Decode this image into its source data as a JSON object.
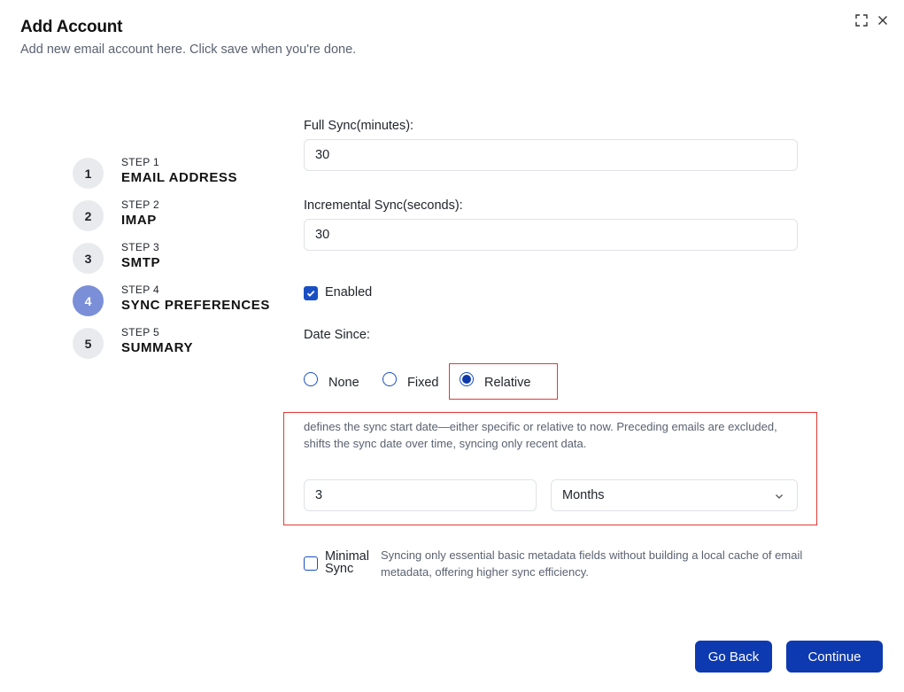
{
  "dialog": {
    "title": "Add Account",
    "subtitle": "Add new email account here. Click save when you're done."
  },
  "steps": [
    {
      "number": "1",
      "label_top": "STEP 1",
      "label": "EMAIL ADDRESS",
      "active": false
    },
    {
      "number": "2",
      "label_top": "STEP 2",
      "label": "IMAP",
      "active": false
    },
    {
      "number": "3",
      "label_top": "STEP 3",
      "label": "SMTP",
      "active": false
    },
    {
      "number": "4",
      "label_top": "STEP 4",
      "label": "SYNC PREFERENCES",
      "active": true
    },
    {
      "number": "5",
      "label_top": "STEP 5",
      "label": "SUMMARY",
      "active": false
    }
  ],
  "form": {
    "full_sync_label": "Full Sync(minutes):",
    "full_sync_value": "30",
    "incremental_sync_label": "Incremental Sync(seconds):",
    "incremental_sync_value": "30",
    "enabled_label": "Enabled",
    "enabled_checked": true,
    "date_since_label": "Date Since:",
    "date_since_options": [
      "None",
      "Fixed",
      "Relative"
    ],
    "date_since_selected": "Relative",
    "date_since_help": "defines the sync start date—either specific or relative to now. Preceding emails are excluded, shifts the sync date over time, syncing only recent data.",
    "relative_amount": "3",
    "relative_unit": "Months",
    "minimal_sync_label": "Minimal Sync",
    "minimal_sync_checked": false,
    "minimal_sync_help": "Syncing only essential basic metadata fields without building a local cache of email metadata, offering higher sync efficiency."
  },
  "buttons": {
    "back": "Go Back",
    "continue": "Continue"
  },
  "colors": {
    "primary": "#0d3ab0",
    "step_active": "#7b8fd8",
    "highlight": "#e53935"
  }
}
